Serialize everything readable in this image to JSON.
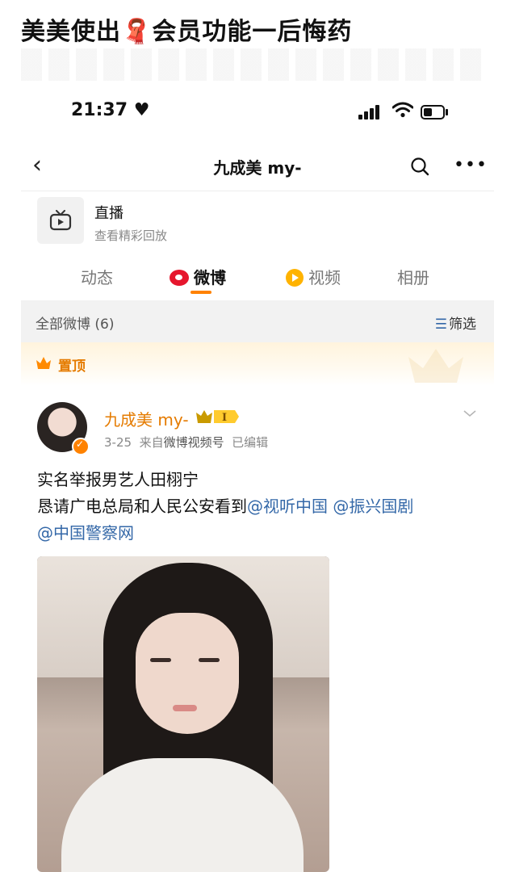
{
  "headline": {
    "text_before": "美美使出",
    "emoji": "🧣",
    "text_after": "会员功能一后悔药"
  },
  "status_bar": {
    "time": "21:37",
    "heart": "♥"
  },
  "nav": {
    "back_glyph": "‹",
    "title": "九成美 my-",
    "more_glyph": "•••"
  },
  "live": {
    "title": "直播",
    "subtitle": "查看精彩回放"
  },
  "tabs": [
    {
      "label": "动态"
    },
    {
      "label": "微博"
    },
    {
      "label": "视频"
    },
    {
      "label": "相册"
    }
  ],
  "filter": {
    "all_label": "全部微博 (6)",
    "filter_label": "筛选",
    "filter_icon": "☰"
  },
  "pinned": {
    "label": "置顶"
  },
  "post": {
    "username": "九成美 my-",
    "vip_level": "I",
    "date": "3-25",
    "source_prefix": "来自",
    "source": "微博视频号",
    "edited": "已编辑",
    "line1": "实名举报男艺人田栩宁",
    "line2_text": "恳请广电总局和人民公安看到",
    "mention1": "@视听中国",
    "mention2": "@振兴国剧",
    "mention3": "@中国警察网"
  },
  "colors": {
    "accent": "#ff8200",
    "link": "#3468a8",
    "name": "#e57b00"
  }
}
